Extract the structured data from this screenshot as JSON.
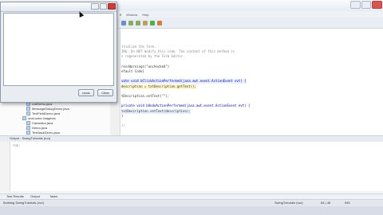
{
  "ide": {
    "title_fragment": "Window   Help",
    "menu": [
      "ff",
      "Window",
      "Help"
    ],
    "toolbar_icons": [
      "save-icon",
      "undo-icon",
      "redo-icon",
      "build-icon",
      "run-icon",
      "debug-icon"
    ]
  },
  "tree": {
    "items": [
      "ListDemo.java",
      "MessageDialogDemo.java",
      "TextFieldDemo.java",
      "oneLooks Imagines",
      "Calculator.java",
      "Demo.java",
      "Text9ackDemo.java"
    ]
  },
  "editor": {
    "lines": [
      {
        "text": "itialize the form.",
        "cls": "cm"
      },
      {
        "text": "ING: Do NOT modify this code. The content of this method is",
        "cls": "cm"
      },
      {
        "text": "s regenerated by the Form Editor.",
        "cls": "cm"
      },
      {
        "text": "",
        "cls": ""
      },
      {
        "text": "ressWarnings(\"unchecked\")",
        "cls": ""
      },
      {
        "text": "efault Code]",
        "cls": ""
      },
      {
        "text": "",
        "cls": ""
      },
      {
        "text": "vate void bClickActionPerformed(java.awt.event.ActionEvent evt) {",
        "cls": "kw hl"
      },
      {
        "text": "  description = txtDescription.getText();",
        "cls": "hl2"
      },
      {
        "text": "",
        "cls": ""
      },
      {
        "text": "tDescription.setText(\"\");",
        "cls": ""
      },
      {
        "text": "",
        "cls": ""
      },
      {
        "text": "  private void bUndoActionPerformed(java.awt.event.ActionEvent evt) {",
        "cls": "kw"
      },
      {
        "text": "    txtDescription.setText(description);",
        "cls": "hl"
      },
      {
        "text": "  }",
        "cls": ""
      },
      {
        "text": "",
        "cls": ""
      },
      {
        "text": "  //",
        "cls": "cm"
      }
    ]
  },
  "output": {
    "title": "Output - SwingTutorials (run)",
    "text": "run:"
  },
  "bottom_tabs": [
    "Test Results",
    "Output",
    "Tasks"
  ],
  "status": {
    "left": "Building SwingTutorials (run)",
    "project": "SwingTutorials (run)",
    "position": "84 | 46",
    "mode": "INS"
  },
  "frame": {
    "undo_label": "Undo",
    "clear_label": "Clear"
  }
}
